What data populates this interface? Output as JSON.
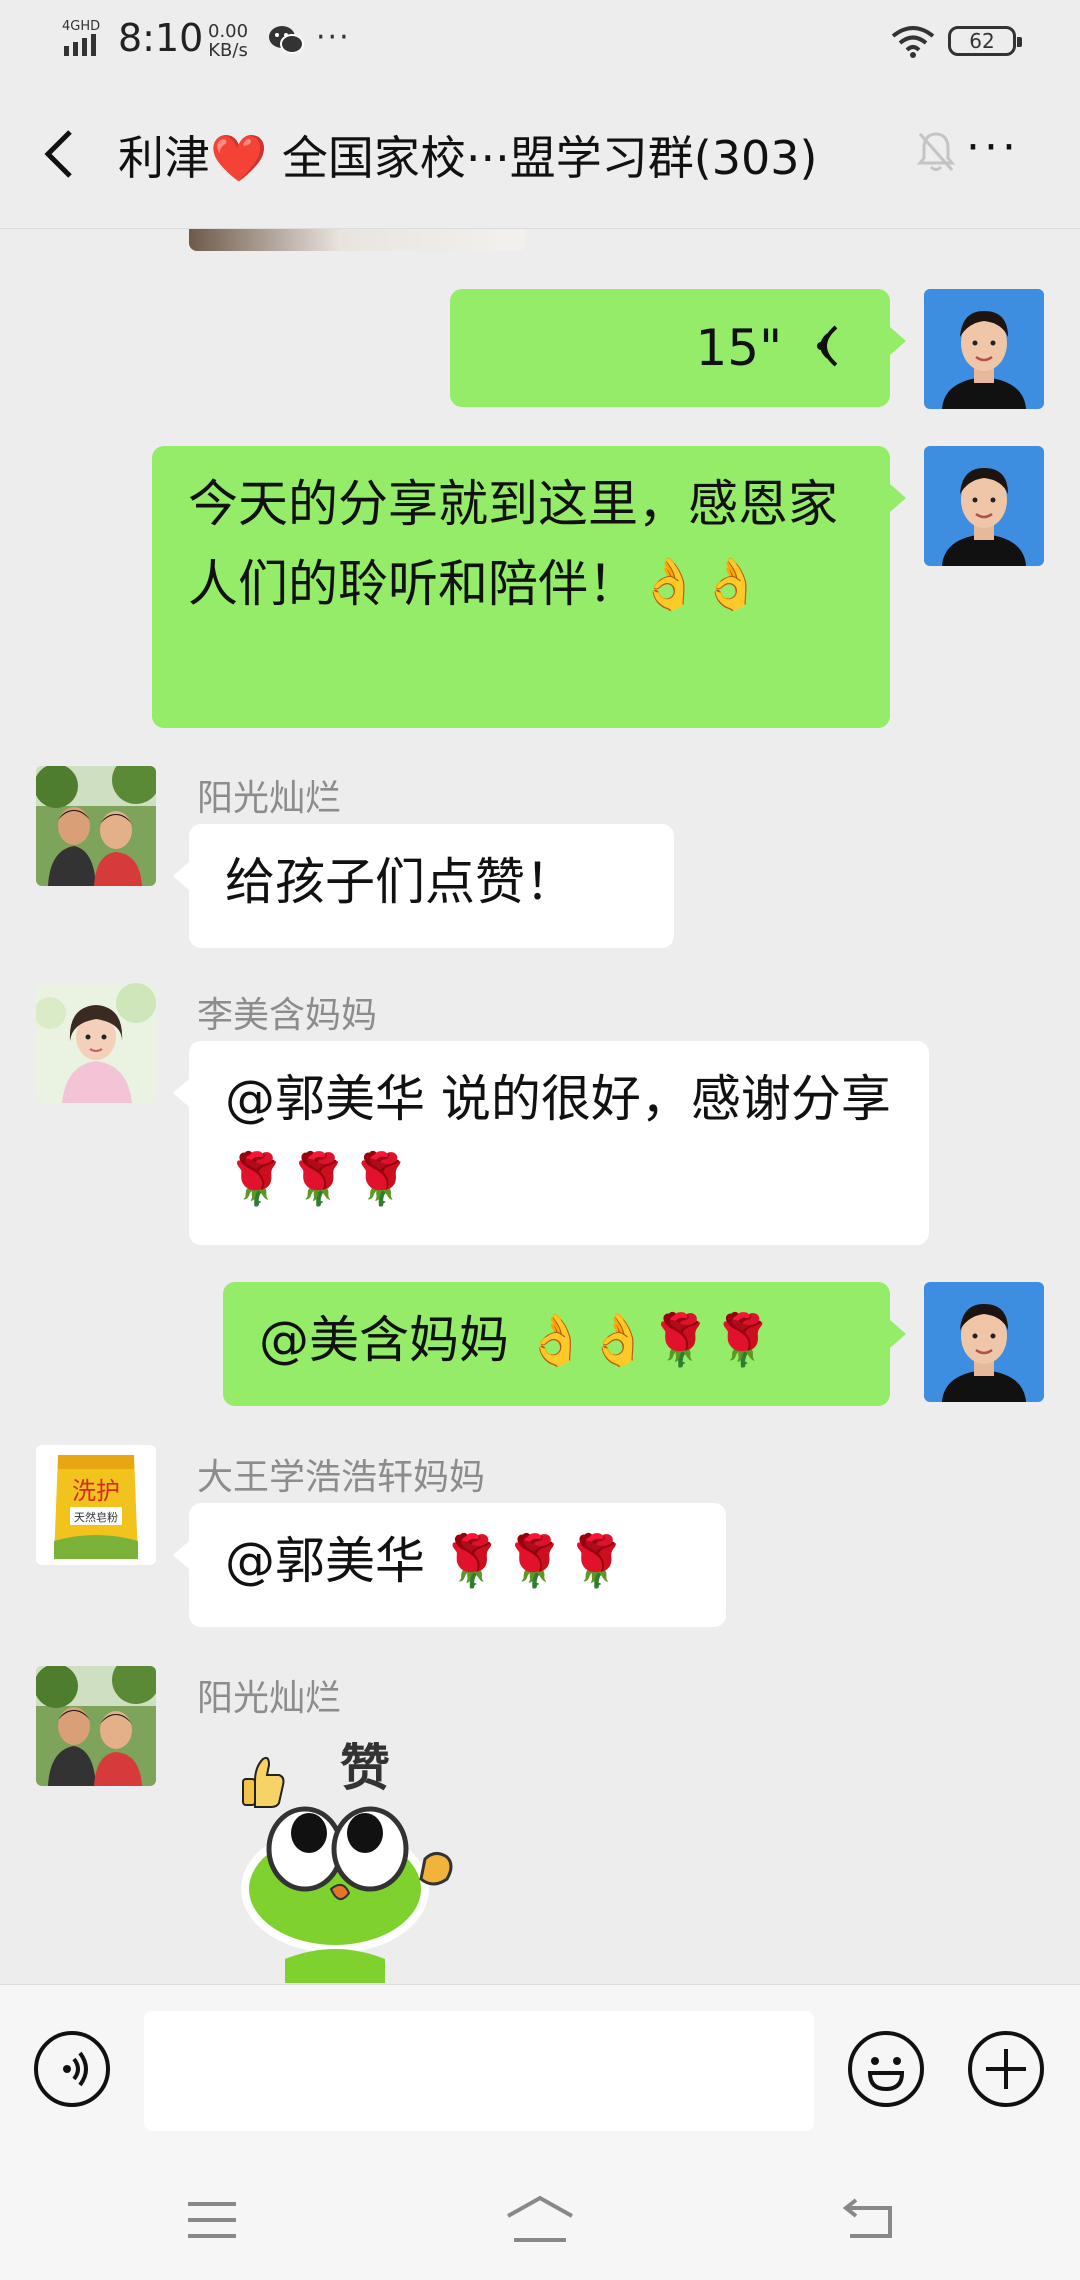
{
  "status_bar": {
    "network": "4GHD",
    "time": "8:10",
    "speed_value": "0.00",
    "speed_unit": "KB/s",
    "more": "···",
    "battery": "62"
  },
  "nav": {
    "title": "利津❤️ 全国家校···盟学习群(303)",
    "more": "···"
  },
  "messages": {
    "voice": {
      "duration": "15\""
    },
    "m1": {
      "text": "今天的分享就到这里，感恩家人们的聆听和陪伴！👌👌"
    },
    "m2": {
      "sender": "阳光灿烂",
      "text": "给孩子们点赞！"
    },
    "m3": {
      "sender": "李美含妈妈",
      "text": "@郭美华  说的很好，感谢分享🌹🌹🌹"
    },
    "m4": {
      "text": "@美含妈妈 👌👌🌹🌹"
    },
    "m5": {
      "sender": "大王学浩浩轩妈妈",
      "text": "@郭美华 🌹🌹🌹"
    },
    "m6": {
      "sender": "阳光灿烂",
      "sticker_text": "赞",
      "sticker_icon": "thumbs-up-frog-sticker"
    }
  },
  "product_avatar": {
    "brand": "洗护",
    "sub": "天然皂粉"
  },
  "colors": {
    "sent_bubble": "#95ec69",
    "received_bubble": "#ffffff",
    "background": "#ededed",
    "sender_name": "#8c8c8c"
  },
  "icons": [
    "back-icon",
    "mute-bell-icon",
    "voice-wave-icon",
    "voice-input-icon",
    "emoji-icon",
    "plus-icon",
    "menu-icon",
    "home-icon",
    "back-nav-icon",
    "wechat-icon",
    "wifi-icon",
    "battery-icon"
  ]
}
